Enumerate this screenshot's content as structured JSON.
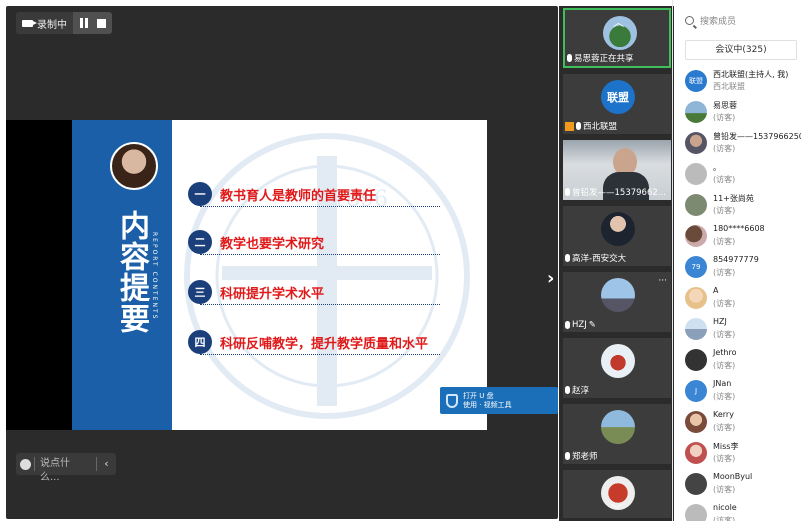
{
  "recording": {
    "label": "录制中"
  },
  "slide": {
    "title_vertical": "内容提要",
    "subtitle_vertical": "REPORT CONTENTS",
    "items": [
      {
        "num": "一",
        "text": "教书育人是教师的首要责任"
      },
      {
        "num": "二",
        "text": "教学也要学术研究"
      },
      {
        "num": "三",
        "text": "科研提升学术水平"
      },
      {
        "num": "四",
        "text": "科研反哺教学，提升教学质量和水平"
      }
    ],
    "watermark_year": "1896"
  },
  "popup": {
    "line1": "打开 U 盘",
    "line2": "使用 · 视频工具"
  },
  "chat": {
    "placeholder": "说点什么..."
  },
  "thumbs": [
    {
      "label": "易思蓉正在共享"
    },
    {
      "badge": "联盟",
      "label": "西北联盟"
    },
    {
      "label": "曾铅发——15379662..."
    },
    {
      "label": "高洋-西安交大"
    },
    {
      "label": "HZJ"
    },
    {
      "label": "赵淳"
    },
    {
      "label": "郑老师"
    },
    {
      "label": ""
    }
  ],
  "members_panel": {
    "search_placeholder": "搜索成员",
    "in_meeting": "会议中(325)",
    "members": [
      {
        "name": "西北联盟(主持人, 我)",
        "role": "西北联盟",
        "avatar_text": "联盟"
      },
      {
        "name": "易思蓉",
        "role": "(访客)"
      },
      {
        "name": "曾铅发——15379662509",
        "role": "(访客)"
      },
      {
        "name": "。",
        "role": "(访客)"
      },
      {
        "name": "11+张尚苑",
        "role": "(访客)"
      },
      {
        "name": "180****6608",
        "role": "(访客)"
      },
      {
        "name": "854977779",
        "role": "(访客)",
        "avatar_text": "79"
      },
      {
        "name": "A",
        "role": "(访客)"
      },
      {
        "name": "HZJ",
        "role": "(访客)"
      },
      {
        "name": "Jethro",
        "role": "(访客)"
      },
      {
        "name": "JNan",
        "role": "(访客)",
        "avatar_text": "J"
      },
      {
        "name": "Kerry",
        "role": "(访客)"
      },
      {
        "name": "Miss李",
        "role": "(访客)"
      },
      {
        "name": "MoonByul",
        "role": "(访客)"
      },
      {
        "name": "nicole",
        "role": "(访客)"
      }
    ]
  }
}
